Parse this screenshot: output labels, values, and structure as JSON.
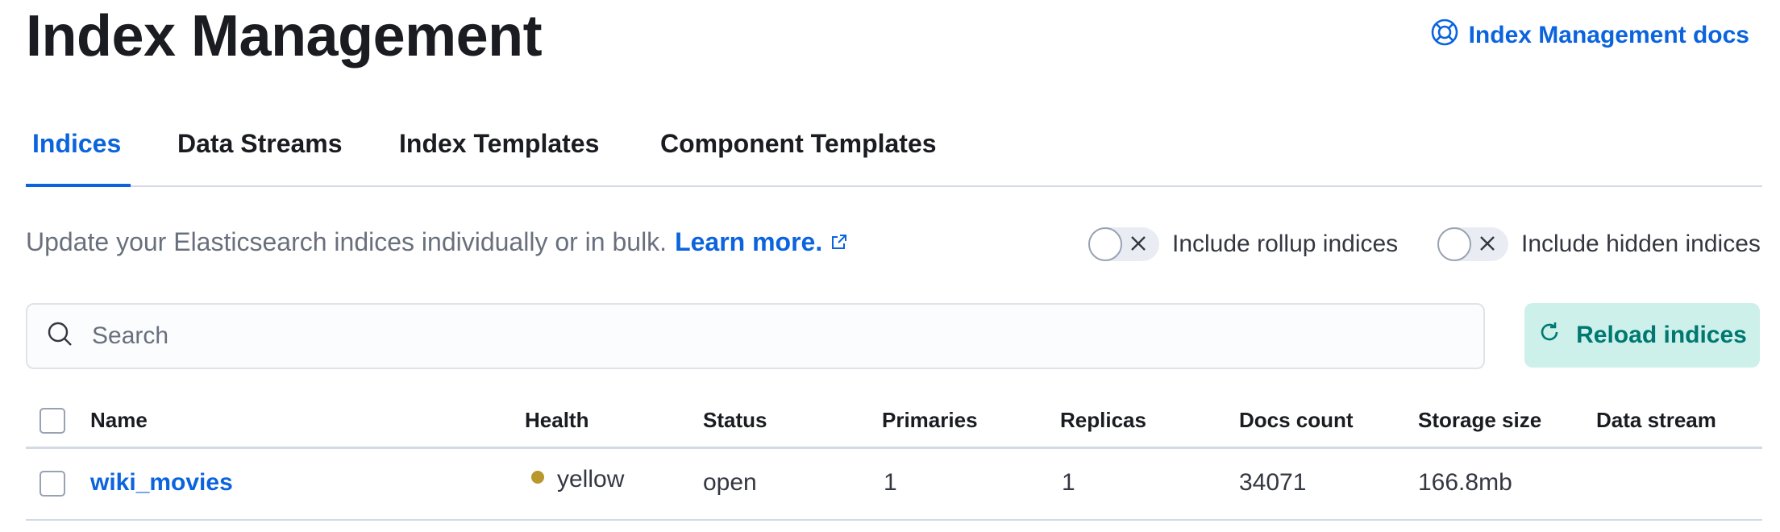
{
  "header": {
    "title": "Index Management",
    "docs_link": "Index Management docs",
    "docs_icon": "lifebuoy-icon"
  },
  "tabs": [
    {
      "label": "Indices",
      "active": true
    },
    {
      "label": "Data Streams",
      "active": false
    },
    {
      "label": "Index Templates",
      "active": false
    },
    {
      "label": "Component Templates",
      "active": false
    }
  ],
  "description": {
    "text": "Update your Elasticsearch indices individually or in bulk.",
    "learn_more": "Learn more.",
    "external_icon": "external-link-icon"
  },
  "toggles": {
    "rollup": {
      "label": "Include rollup indices",
      "on": false
    },
    "hidden": {
      "label": "Include hidden indices",
      "on": false
    }
  },
  "search": {
    "placeholder": "Search",
    "value": "",
    "icon": "search-icon"
  },
  "reload_button": {
    "label": "Reload indices",
    "icon": "refresh-icon"
  },
  "table": {
    "columns": [
      "Name",
      "Health",
      "Status",
      "Primaries",
      "Replicas",
      "Docs count",
      "Storage size",
      "Data stream"
    ],
    "rows": [
      {
        "name": "wiki_movies",
        "health": "yellow",
        "status": "open",
        "primaries": "1",
        "replicas": "1",
        "docs_count": "34071",
        "storage_size": "166.8mb",
        "data_stream": ""
      }
    ]
  },
  "colors": {
    "accent": "#0b64dd",
    "health_yellow": "#b9972c",
    "reload_bg": "#cdf1ea",
    "reload_text": "#007871"
  }
}
